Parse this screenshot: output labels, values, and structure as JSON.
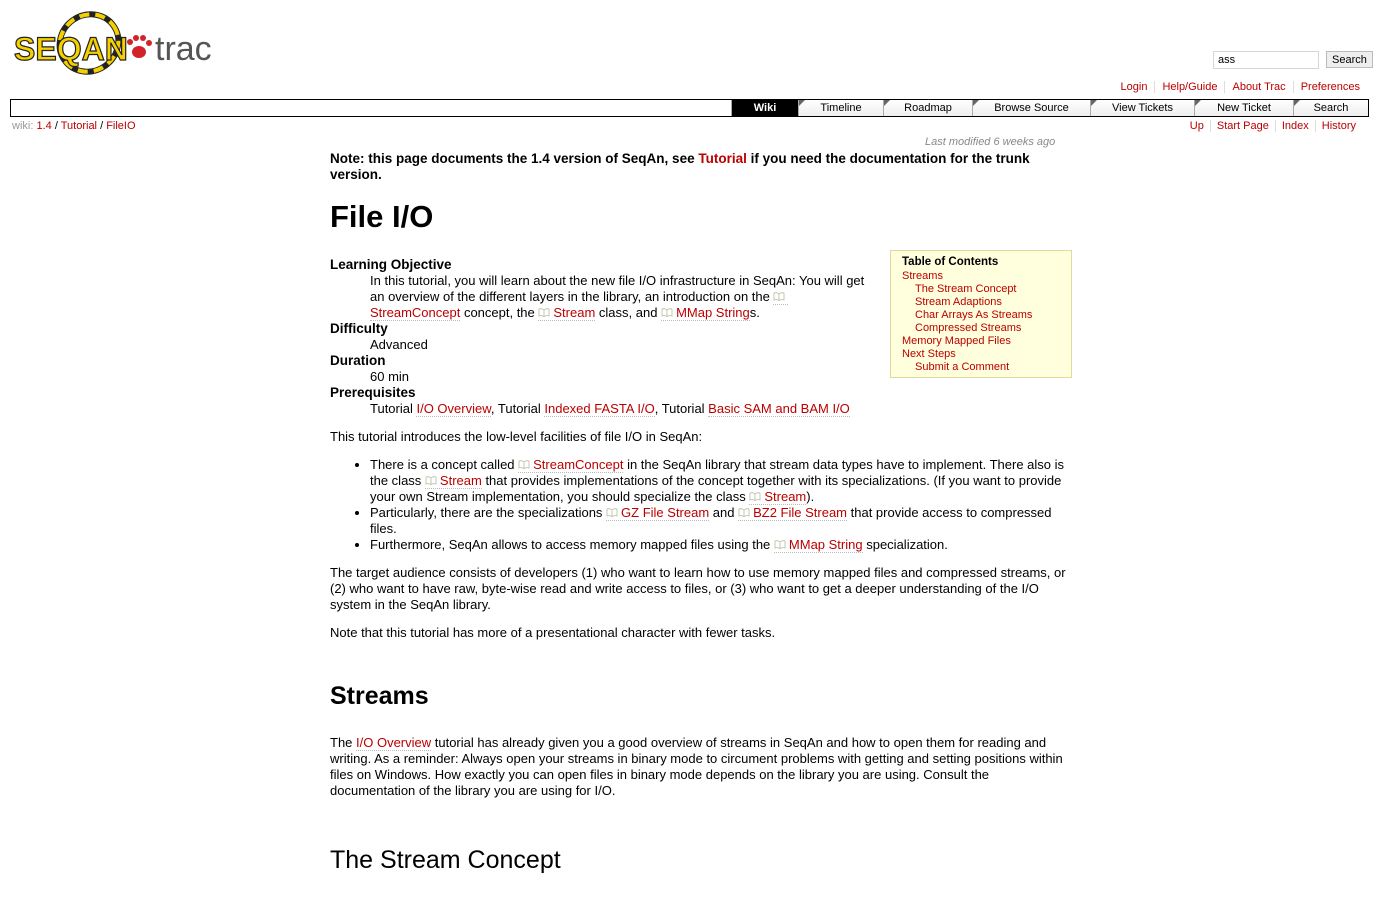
{
  "logo": {
    "text_left": "SEQAN",
    "text_right": "trac"
  },
  "search": {
    "value": "ass",
    "button": "Search"
  },
  "metanav": [
    "Login",
    "Help/Guide",
    "About Trac",
    "Preferences"
  ],
  "mainnav": [
    {
      "label": "Wiki",
      "active": true
    },
    {
      "label": "Timeline"
    },
    {
      "label": "Roadmap"
    },
    {
      "label": "Browse Source"
    },
    {
      "label": "View Tickets"
    },
    {
      "label": "New Ticket"
    },
    {
      "label": "Search"
    }
  ],
  "breadcrumb": {
    "prefix": "wiki:",
    "items": [
      "1.4",
      "Tutorial",
      "FileIO"
    ],
    "sep": "/"
  },
  "ctxtnav": [
    "Up",
    "Start Page",
    "Index",
    "History"
  ],
  "last_modified": "Last modified 6 weeks ago",
  "note": {
    "before": "Note: this page documents the 1.4 version of SeqAn, see ",
    "link": "Tutorial",
    "after": " if you need the documentation for the trunk version."
  },
  "title": "File I/O",
  "toc": {
    "title": "Table of Contents",
    "items": [
      {
        "label": "Streams",
        "level": 1
      },
      {
        "label": "The Stream Concept",
        "level": 2
      },
      {
        "label": "Stream Adaptions",
        "level": 2
      },
      {
        "label": "Char Arrays As Streams",
        "level": 2
      },
      {
        "label": "Compressed Streams",
        "level": 2
      },
      {
        "label": "Memory Mapped Files",
        "level": 1
      },
      {
        "label": "Next Steps",
        "level": 1
      },
      {
        "label": "Submit a Comment",
        "level": 2
      }
    ]
  },
  "meta": {
    "objective_label": "Learning Objective",
    "objective": {
      "t1": "In this tutorial, you will learn about the new file I/O infrastructure in SeqAn: You will get an overview of the different layers in the library, an introduction on the ",
      "l1": "StreamConcept",
      "t2": " concept, the ",
      "l2": "Stream",
      "t3": " class, and ",
      "l3": "MMap String",
      "t4": "s."
    },
    "difficulty_label": "Difficulty",
    "difficulty": "Advanced",
    "duration_label": "Duration",
    "duration": "60 min",
    "prereq_label": "Prerequisites",
    "prereq": {
      "t1": "Tutorial ",
      "l1": "I/O Overview",
      "t2": ", Tutorial ",
      "l2": "Indexed FASTA I/O",
      "t3": ", Tutorial ",
      "l3": "Basic SAM and BAM I/O"
    }
  },
  "intro": "This tutorial introduces the low-level facilities of file I/O in SeqAn:",
  "bullets": {
    "b1": {
      "t1": "There is a concept called ",
      "l1": "StreamConcept",
      "t2": " in the SeqAn library that stream data types have to implement. There also is the class ",
      "l2": "Stream",
      "t3": " that provides implementations of the concept together with its specializations. (If you want to provide your own Stream implementation, you should specialize the class ",
      "l3": "Stream",
      "t4": ")."
    },
    "b2": {
      "t1": "Particularly, there are the specializations ",
      "l1": "GZ File Stream",
      "t2": " and ",
      "l2": "BZ2 File Stream",
      "t3": " that provide access to compressed files."
    },
    "b3": {
      "t1": "Furthermore, SeqAn allows to access memory mapped files using the ",
      "l1": "MMap String",
      "t2": " specialization."
    }
  },
  "audience": "The target audience consists of developers (1) who want to learn how to use memory mapped files and compressed streams, or (2) who want to have raw, byte-wise read and write access to files, or (3) who want to get a deeper understanding of the I/O system in the SeqAn library.",
  "note2": "Note that this tutorial has more of a presentational character with fewer tasks.",
  "streams_heading": "Streams",
  "streams_para": {
    "t1": "The ",
    "l1": "I/O Overview",
    "t2": " tutorial has already given you a good overview of streams in SeqAn and how to open them for reading and writing. As a reminder: Always open your streams in binary mode to circument problems with getting and setting positions within files on Windows. How exactly you can open files in binary mode depends on the library you are using. Consult the documentation of the library you are using for I/O."
  },
  "stream_concept_heading": "The Stream Concept",
  "colors": {
    "link": "#bb0000",
    "logo_yellow": "#f5d000",
    "logo_red": "#d2232a",
    "toc_bg": "#ffffdd"
  }
}
